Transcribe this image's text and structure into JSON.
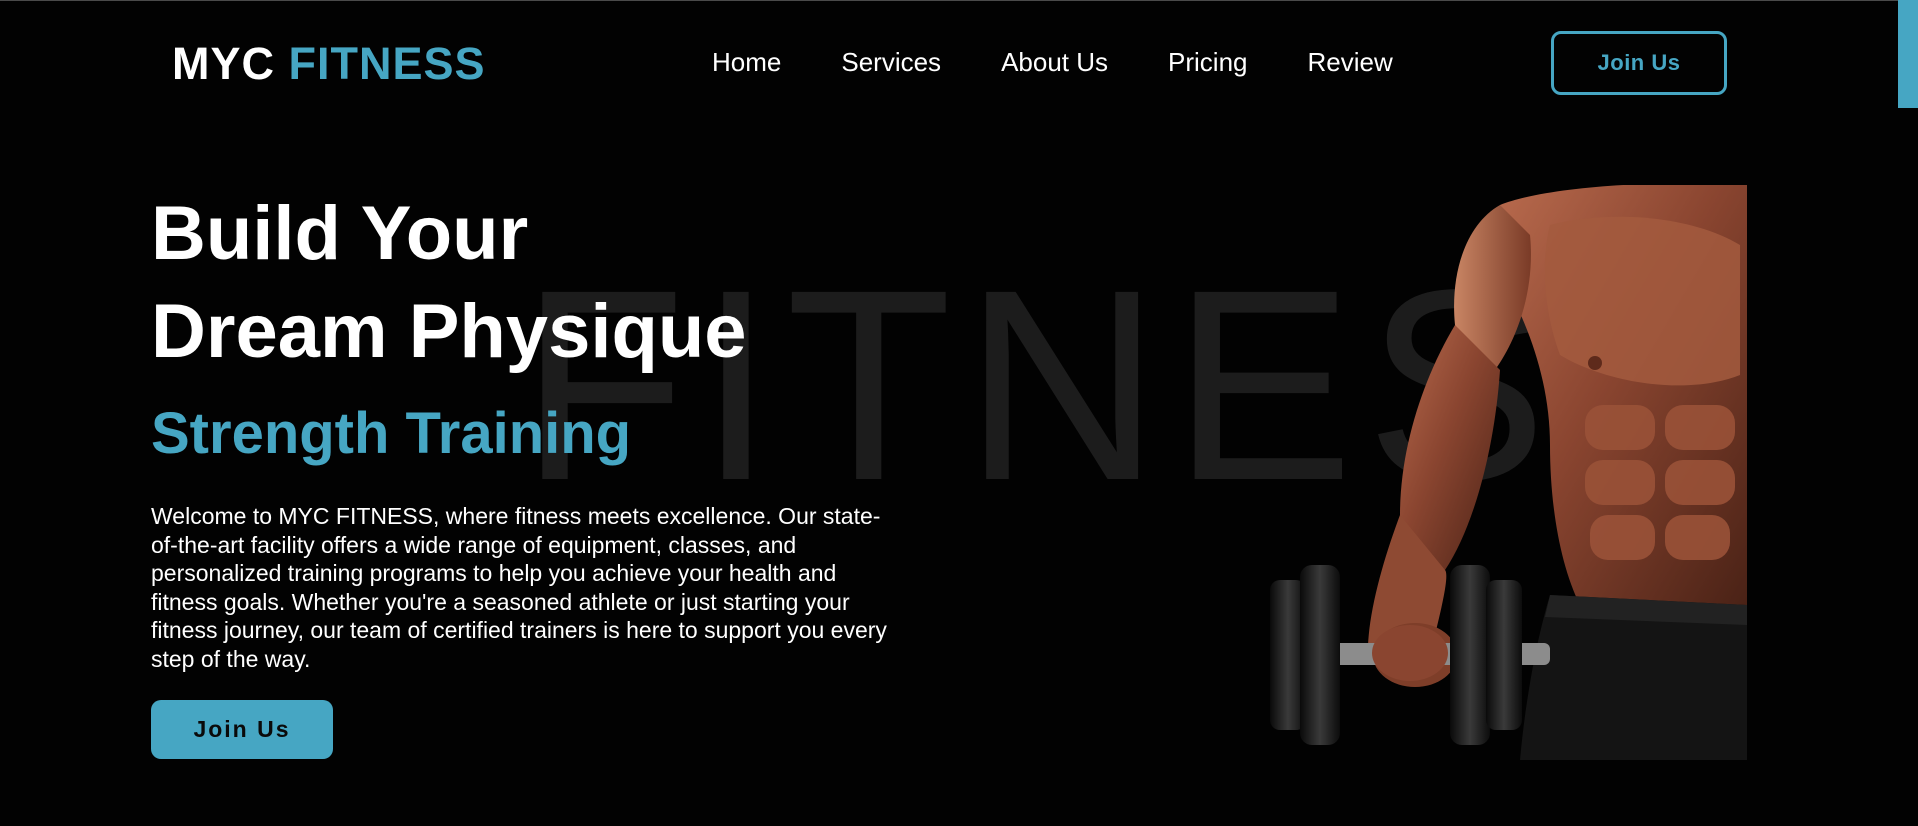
{
  "brand": {
    "logo_part1": "MYC",
    "logo_part2": "FITNESS"
  },
  "nav": {
    "items": [
      {
        "label": "Home"
      },
      {
        "label": "Services"
      },
      {
        "label": "About Us"
      },
      {
        "label": "Pricing"
      },
      {
        "label": "Review"
      }
    ],
    "cta_label": "Join Us"
  },
  "hero": {
    "watermark": "FITNESS",
    "title_line1": "Build Your",
    "title_line2": "Dream Physique",
    "subtitle": "Strength Training",
    "description": "Welcome to MYC FITNESS, where fitness meets excellence. Our state-of-the-art facility offers a wide range of equipment, classes, and personalized training programs to help you achieve your health and fitness goals. Whether you're a seasoned athlete or just starting your fitness journey, our team of certified trainers is here to support you every step of the way.",
    "cta_label": "Join Us"
  },
  "colors": {
    "accent": "#46a6c3",
    "background": "#020202",
    "text": "#ffffff",
    "watermark": "#1c1c1c"
  }
}
